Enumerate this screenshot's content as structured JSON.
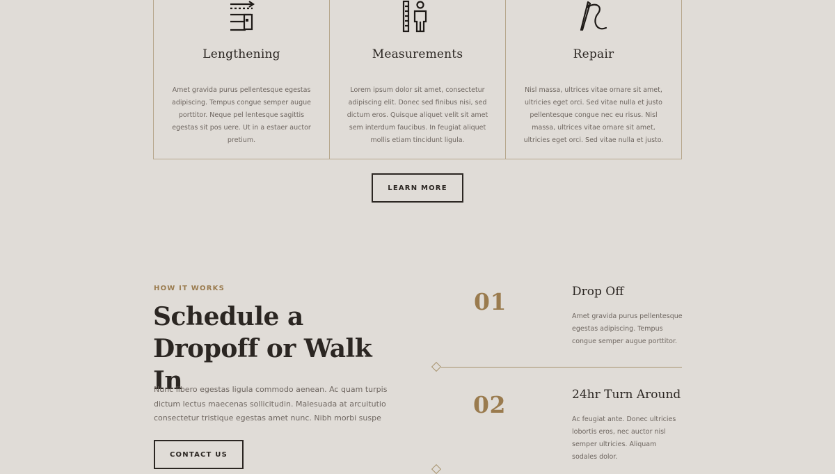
{
  "services": [
    {
      "icon": "measuring-tape-icon",
      "title": "Lengthening",
      "description": "Amet gravida purus pellentesque egestas adipiscing. Tempus congue semper augue porttitor. Neque pel lentesque sagittis egestas sit pos uere. Ut in a estaer auctor pretium."
    },
    {
      "icon": "ruler-person-icon",
      "title": "Measurements",
      "description": "Lorem ipsum dolor sit amet, consectetur adipiscing elit. Donec sed finibus nisi, sed dictum eros. Quisque aliquet velit sit amet sem interdum faucibus. In feugiat aliquet mollis etiam tincidunt ligula."
    },
    {
      "icon": "needle-thread-icon",
      "title": "Repair",
      "description": "Nisl massa, ultrices vitae ornare sit amet, ultricies eget orci. Sed vitae nulla et justo pellentesque congue nec eu risus. Nisl massa, ultrices vitae ornare sit amet, ultricies eget orci. Sed vitae nulla et justo."
    }
  ],
  "learn_more": "LEARN MORE",
  "how_it_works": {
    "eyebrow": "HOW IT WORKS",
    "title": "Schedule a Dropoff or Walk In",
    "body": "Nunc libero egestas ligula commodo aenean. Ac quam turpis dictum lectus maecenas sollicitudin. Malesuada at arcuitutio consectetur tristique egestas amet nunc. Nibh morbi suspe",
    "cta": "CONTACT US"
  },
  "steps": [
    {
      "number": "01",
      "title": "Drop Off",
      "description": "Amet gravida purus pellentesque egestas adipiscing. Tempus congue semper augue porttitor."
    },
    {
      "number": "02",
      "title": "24hr Turn Around",
      "description": "Ac feugiat ante. Donec ultricies lobortis eros, nec auctor nisl semper ultricies. Aliquam sodales dolor."
    }
  ],
  "colors": {
    "background": "#e0dcd7",
    "accent": "#9a7b4e",
    "text": "#2b2622",
    "border": "#b7a78d"
  }
}
